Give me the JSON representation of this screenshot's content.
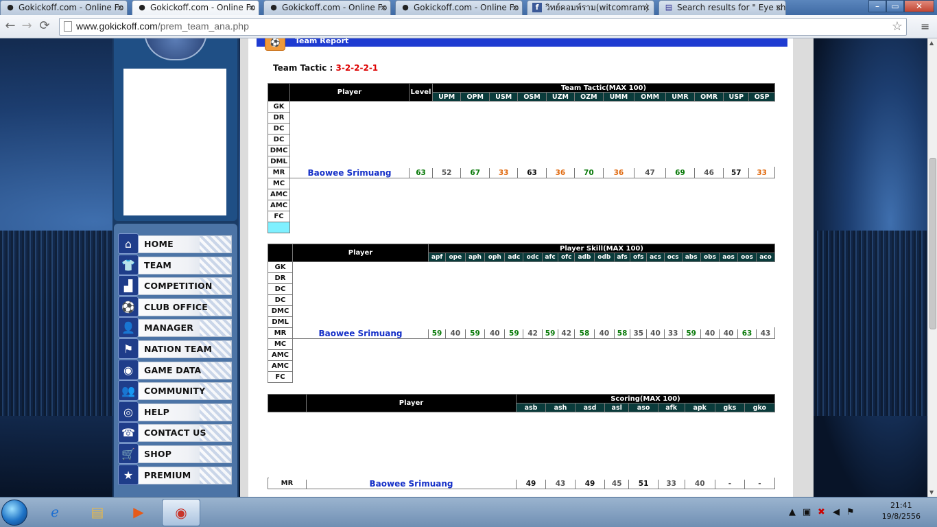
{
  "browser": {
    "tabs": [
      {
        "title": "Gokickoff.com - Online Fo",
        "icon": "person-icon",
        "left": 0
      },
      {
        "title": "Gokickoff.com - Online Fo",
        "icon": "person-icon",
        "active": true
      },
      {
        "title": "Gokickoff.com - Online Fo",
        "icon": "person-icon"
      },
      {
        "title": "Gokickoff.com - Online Fo",
        "icon": "person-icon"
      },
      {
        "title": "วิทย์คอมพ์ราม(witcomram)",
        "icon": "facebook-icon"
      },
      {
        "title": "Search results for \" Eye shi",
        "icon": "thai-flag-icon"
      }
    ],
    "url_host": "www.gokickoff.com",
    "url_path": "/prem_team_ana.php"
  },
  "page": {
    "report_title": "Team Report",
    "tactic_label": "Team Tactic : ",
    "tactic_value": "3-2-2-2-1"
  },
  "menu": [
    {
      "label": "HOME",
      "icon": "house-icon",
      "glyph": "⌂"
    },
    {
      "label": "TEAM",
      "icon": "shirt-icon",
      "glyph": "👕"
    },
    {
      "label": "COMPETITION",
      "icon": "podium-icon",
      "glyph": "▟"
    },
    {
      "label": "CLUB OFFICE",
      "icon": "soccer-ball-icon",
      "glyph": "⚽"
    },
    {
      "label": "MANAGER",
      "icon": "manager-icon",
      "glyph": "👤"
    },
    {
      "label": "NATION TEAM",
      "icon": "flag-icon",
      "glyph": "⚑"
    },
    {
      "label": "GAME DATA",
      "icon": "game-data-icon",
      "glyph": "◉"
    },
    {
      "label": "COMMUNITY",
      "icon": "community-icon",
      "glyph": "👥"
    },
    {
      "label": "HELP",
      "icon": "lifebuoy-icon",
      "glyph": "◎"
    },
    {
      "label": "CONTACT US",
      "icon": "phone-icon",
      "glyph": "☎"
    },
    {
      "label": "SHOP",
      "icon": "cart-icon",
      "glyph": "🛒"
    },
    {
      "label": "PREMIUM",
      "icon": "star-icon",
      "glyph": "★"
    }
  ],
  "table1": {
    "col_player": "Player",
    "col_level": "Level",
    "group": "Team Tactic(MAX 100)",
    "subcols": [
      "UPM",
      "OPM",
      "USM",
      "OSM",
      "UZM",
      "OZM",
      "UMM",
      "OMM",
      "UMR",
      "OMR",
      "USP",
      "OSP"
    ],
    "positions": [
      "GK",
      "DR",
      "DC",
      "DC",
      "DMC",
      "DML",
      "MR",
      "MC",
      "AMC",
      "AMC",
      "FC",
      ""
    ],
    "player_row": {
      "pos": "MR",
      "name": "Baowee Srimuang",
      "values": [
        "63",
        "52",
        "67",
        "33",
        "63",
        "36",
        "70",
        "36",
        "47",
        "69",
        "46",
        "57",
        "33"
      ],
      "colors": [
        "g",
        "gr",
        "g",
        "o",
        "k",
        "o",
        "g",
        "o",
        "gr",
        "g",
        "gr",
        "k",
        "o"
      ]
    }
  },
  "table2": {
    "col_player": "Player",
    "group": "Player Skill(MAX 100)",
    "subcols": [
      "apf",
      "ope",
      "aph",
      "oph",
      "adc",
      "odc",
      "afc",
      "ofc",
      "adb",
      "odb",
      "afs",
      "ofs",
      "acs",
      "ocs",
      "abs",
      "obs",
      "aos",
      "oos",
      "aco"
    ],
    "positions": [
      "GK",
      "DR",
      "DC",
      "DC",
      "DMC",
      "DML",
      "MR",
      "MC",
      "AMC",
      "AMC",
      "FC"
    ],
    "player_row": {
      "pos": "MR",
      "name": "Baowee Srimuang",
      "values": [
        "59",
        "40",
        "59",
        "40",
        "59",
        "42",
        "59",
        "42",
        "58",
        "40",
        "58",
        "35",
        "40",
        "33",
        "59",
        "40",
        "40",
        "63",
        "43"
      ],
      "colors": [
        "g",
        "gr",
        "g",
        "gr",
        "g",
        "gr",
        "g",
        "gr",
        "g",
        "gr",
        "g",
        "gr",
        "gr",
        "gr",
        "g",
        "gr",
        "gr",
        "g",
        "gr"
      ]
    }
  },
  "table3": {
    "col_player": "Player",
    "group": "Scoring(MAX 100)",
    "subcols": [
      "asb",
      "ash",
      "asd",
      "asl",
      "aso",
      "afk",
      "apk",
      "gks",
      "gko"
    ],
    "player_row": {
      "pos": "MR",
      "name": "Baowee Srimuang",
      "values": [
        "49",
        "43",
        "49",
        "45",
        "51",
        "33",
        "40",
        "-",
        "-"
      ],
      "colors": [
        "k",
        "gr",
        "k",
        "gr",
        "k",
        "gr",
        "gr",
        "gr",
        "gr"
      ]
    }
  },
  "taskbar": {
    "time": "21:41",
    "date": "19/8/2556"
  }
}
